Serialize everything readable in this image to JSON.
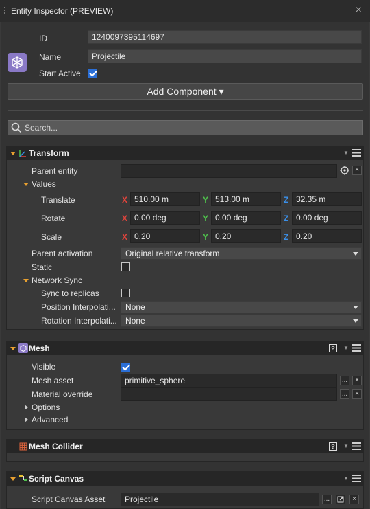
{
  "window": {
    "title": "Entity Inspector (PREVIEW)",
    "close_glyph": "×"
  },
  "entity": {
    "id_label": "ID",
    "id_value": "1240097395114697",
    "name_label": "Name",
    "name_value": "Projectile",
    "start_active_label": "Start Active",
    "start_active": true,
    "add_component_label": "Add Component ▾",
    "search_placeholder": "Search..."
  },
  "transform": {
    "title": "Transform",
    "parent_entity_label": "Parent entity",
    "parent_entity_value": "",
    "values_label": "Values",
    "translate_label": "Translate",
    "translate": {
      "x": "510.00 m",
      "y": "513.00 m",
      "z": "32.35 m"
    },
    "rotate_label": "Rotate",
    "rotate": {
      "x": "0.00 deg",
      "y": "0.00 deg",
      "z": "0.00 deg"
    },
    "scale_label": "Scale",
    "scale": {
      "x": "0.20",
      "y": "0.20",
      "z": "0.20"
    },
    "axis_x": "X",
    "axis_y": "Y",
    "axis_z": "Z",
    "parent_activation_label": "Parent activation",
    "parent_activation_value": "Original relative transform",
    "static_label": "Static",
    "static": false,
    "network_sync_label": "Network Sync",
    "sync_to_replicas_label": "Sync to replicas",
    "sync_to_replicas": false,
    "position_interp_label": "Position Interpolati...",
    "position_interp_value": "None",
    "rotation_interp_label": "Rotation Interpolati...",
    "rotation_interp_value": "None"
  },
  "mesh": {
    "title": "Mesh",
    "visible_label": "Visible",
    "visible": true,
    "mesh_asset_label": "Mesh asset",
    "mesh_asset_value": "primitive_sphere",
    "material_override_label": "Material override",
    "material_override_value": "",
    "options_label": "Options",
    "advanced_label": "Advanced",
    "browse_glyph": "...",
    "clear_glyph": "×",
    "help_glyph": "?"
  },
  "mesh_collider": {
    "title": "Mesh Collider"
  },
  "script_canvas": {
    "title": "Script Canvas",
    "asset_label": "Script Canvas Asset",
    "asset_value": "Projectile"
  },
  "colors": {
    "accent_blue": "#2b6fd6",
    "axis_x": "#e0443c",
    "axis_y": "#4fc24c",
    "axis_z": "#3a8fe8",
    "expand_arrow": "#e8a030"
  }
}
